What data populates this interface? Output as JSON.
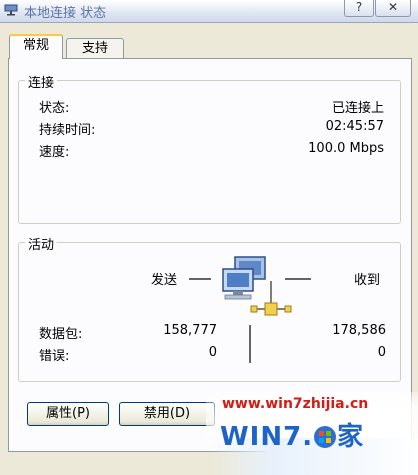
{
  "window": {
    "title": "本地连接 状态",
    "help_label": "?",
    "close_label": "✕"
  },
  "tabs": [
    {
      "label": "常规",
      "active": true
    },
    {
      "label": "支持",
      "active": false
    }
  ],
  "connection": {
    "legend": "连接",
    "rows": [
      {
        "label": "状态:",
        "value": "已连接上"
      },
      {
        "label": "持续时间:",
        "value": "02:45:57"
      },
      {
        "label": "速度:",
        "value": "100.0 Mbps"
      }
    ]
  },
  "activity": {
    "legend": "活动",
    "sent_label": "发送",
    "received_label": "收到",
    "rows": [
      {
        "label": "数据包:",
        "sent": "158,777",
        "received": "178,586"
      },
      {
        "label": "错误:",
        "sent": "0",
        "received": "0"
      }
    ]
  },
  "buttons": {
    "properties": "属性(P)",
    "disable": "禁用(D)"
  },
  "watermark": {
    "url": "www.win7zhijia.cn",
    "logo_text": "WIN7",
    "logo_suffix": "家"
  },
  "colors": {
    "window_bg": "#ece9d8",
    "panel_bg": "#fcfcfe",
    "tab_highlight": "#ffc83c",
    "watermark_red": "#d41b16",
    "watermark_blue": "#1e63c8"
  },
  "icons": [
    "network-connection-icon",
    "help-icon",
    "close-icon",
    "network-activity-icon"
  ]
}
